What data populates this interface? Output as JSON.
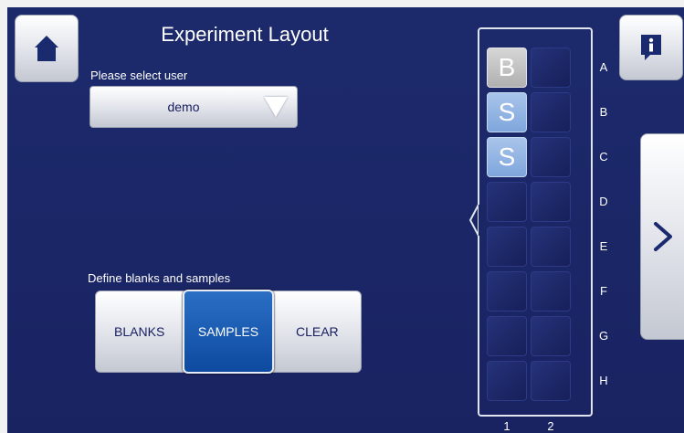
{
  "header": {
    "title": "Experiment Layout"
  },
  "icons": {
    "home": "home-icon",
    "info": "info-icon",
    "next": "chevron-right-icon",
    "dropdown": "triangle-down-icon"
  },
  "user": {
    "label": "Please select user",
    "selected": "demo"
  },
  "define": {
    "label": "Define blanks and samples",
    "options": [
      "BLANKS",
      "SAMPLES",
      "CLEAR"
    ],
    "active": "SAMPLES"
  },
  "plate": {
    "rows": [
      "A",
      "B",
      "C",
      "D",
      "E",
      "F",
      "G",
      "H"
    ],
    "columns": [
      "1",
      "2"
    ],
    "wells": [
      {
        "row": "A",
        "col": "1",
        "value": "B",
        "type": "blank"
      },
      {
        "row": "B",
        "col": "1",
        "value": "S",
        "type": "sample"
      },
      {
        "row": "C",
        "col": "1",
        "value": "S",
        "type": "sample"
      }
    ]
  },
  "colors": {
    "background": "#1a2466",
    "blank_well": "#b8b8b8",
    "sample_well": "#8fb2e2",
    "active_segment": "#0d4aa0"
  }
}
